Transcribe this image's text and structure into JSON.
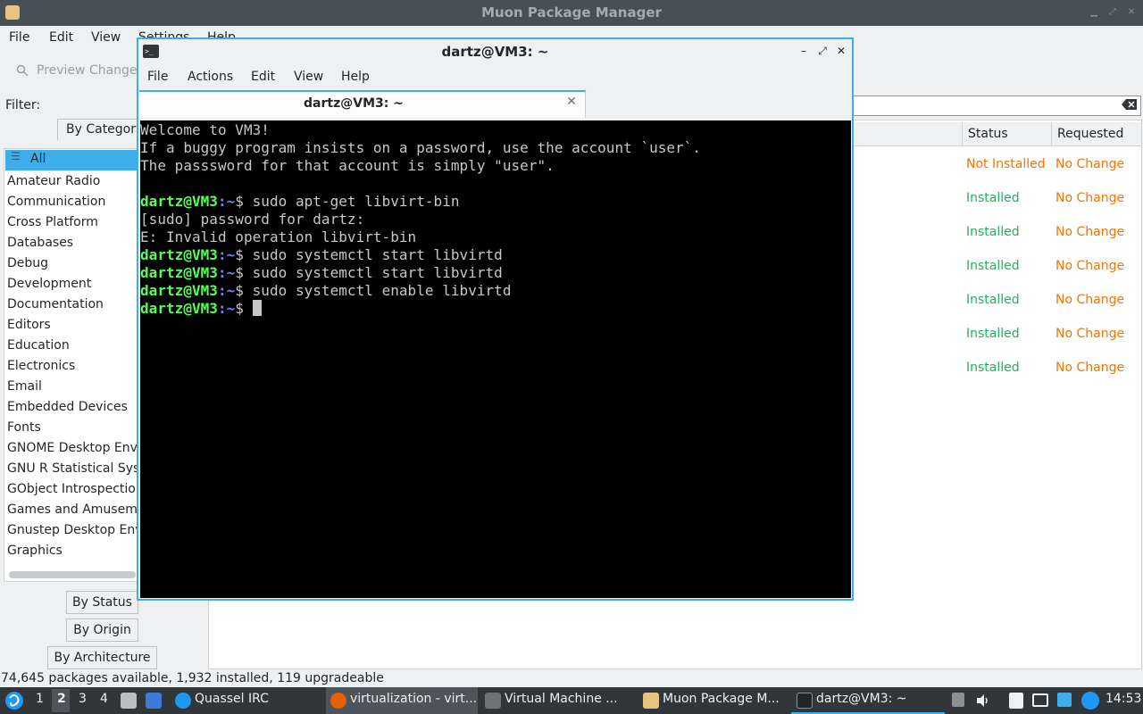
{
  "muon": {
    "title": "Muon Package Manager",
    "menu": [
      "File",
      "Edit",
      "View",
      "Settings",
      "Help"
    ],
    "toolbar": {
      "preview_label": "Preview Changes"
    },
    "filter_label": "Filter:",
    "category_tab": "By Category",
    "categories": [
      "All",
      "Amateur Radio",
      "Communication",
      "Cross Platform",
      "Databases",
      "Debug",
      "Development",
      "Documentation",
      "Editors",
      "Education",
      "Electronics",
      "Email",
      "Embedded Devices",
      "Fonts",
      "GNOME Desktop Envi",
      "GNU R Statistical Syst",
      "GObject Introspection",
      "Games and Amuseme",
      "Gnustep Desktop Env",
      "Graphics"
    ],
    "bottom_tabs": [
      "By Status",
      "By Origin",
      "By Architecture"
    ],
    "columns": {
      "status": "Status",
      "requested": "Requested"
    },
    "rows": [
      {
        "status": "Not Installed",
        "requested": "No Change"
      },
      {
        "status": "Installed",
        "requested": "No Change"
      },
      {
        "status": "Installed",
        "requested": "No Change"
      },
      {
        "status": "Installed",
        "requested": "No Change"
      },
      {
        "status": "Installed",
        "requested": "No Change"
      },
      {
        "status": "Installed",
        "requested": "No Change"
      },
      {
        "status": "Installed",
        "requested": "No Change"
      }
    ],
    "status_bar": "74,645 packages available, 1,932 installed, 119 upgradeable",
    "colors": {
      "installed": "#27ae60",
      "not_installed": "#f67400",
      "no_change": "#f67400",
      "accent": "#3daee9"
    }
  },
  "terminal": {
    "title": "dartz@VM3: ~",
    "menu": [
      "File",
      "Actions",
      "Edit",
      "View",
      "Help"
    ],
    "tab_label": "dartz@VM3: ~",
    "lines": [
      "Welcome to VM3!",
      "If a buggy program insists on a password, use the account `user`.",
      "The passsword for that account is simply \"user\".",
      "",
      "",
      "[sudo] password for dartz:",
      "E: Invalid operation libvirt-bin"
    ],
    "prompt_user": "dartz@VM3",
    "prompt_path": ":~",
    "prompt_symbol": "$ ",
    "commands": [
      "sudo apt-get libvirt-bin",
      "sudo systemctl start libvirtd",
      "sudo systemctl start libvirtd",
      "sudo systemctl enable libvirtd",
      ""
    ]
  },
  "taskbar": {
    "desktops": [
      "1",
      "2",
      "3",
      "4"
    ],
    "tasks": [
      "Quassel IRC",
      "virtualization - virt...",
      "Virtual Machine ...",
      "Muon Package M...",
      "dartz@VM3: ~"
    ],
    "clock": "14:53"
  }
}
